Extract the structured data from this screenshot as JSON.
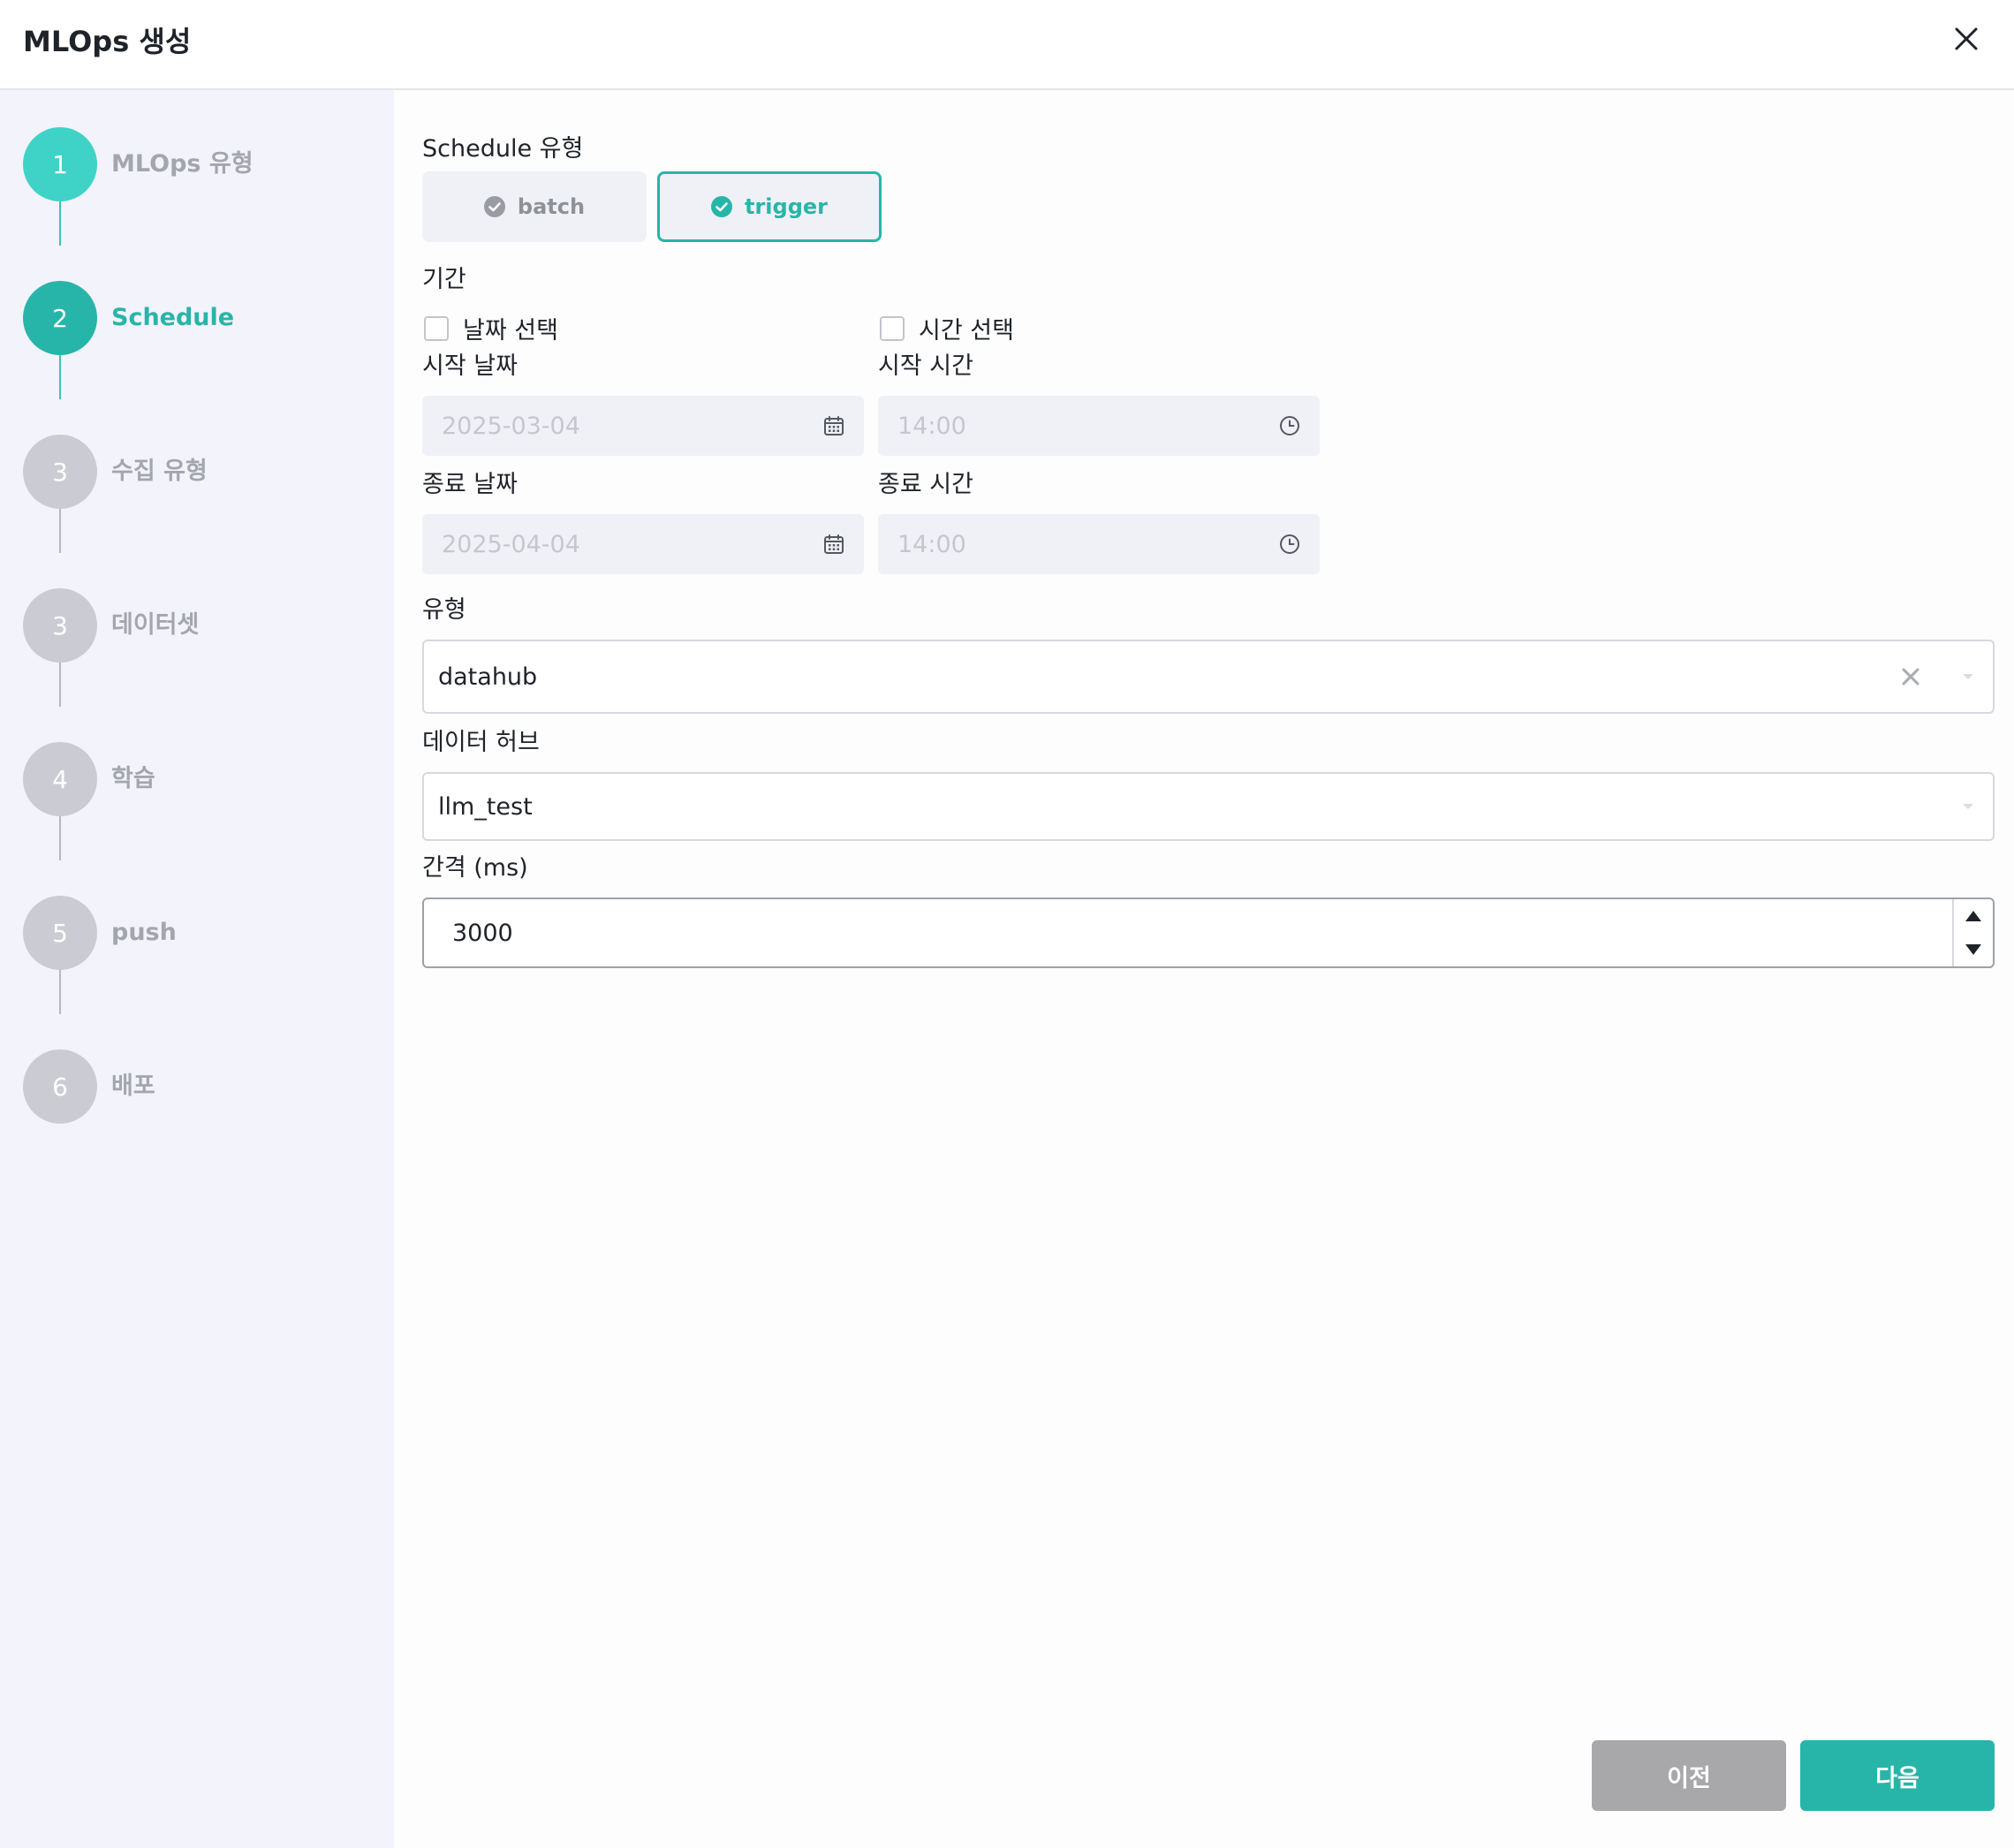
{
  "dialog": {
    "title": "MLOps 생성"
  },
  "steps": [
    {
      "number": "1",
      "label": "MLOps 유형",
      "state": "done"
    },
    {
      "number": "2",
      "label": "Schedule",
      "state": "active"
    },
    {
      "number": "3",
      "label": "수집 유형",
      "state": "pending"
    },
    {
      "number": "3",
      "label": "데이터셋",
      "state": "pending"
    },
    {
      "number": "4",
      "label": "학습",
      "state": "pending"
    },
    {
      "number": "5",
      "label": "push",
      "state": "pending"
    },
    {
      "number": "6",
      "label": "배포",
      "state": "pending"
    }
  ],
  "schedule": {
    "type_label": "Schedule 유형",
    "options": {
      "batch": "batch",
      "trigger": "trigger"
    },
    "selected": "trigger"
  },
  "period": {
    "label": "기간",
    "date_checkbox": "날짜 선택",
    "time_checkbox": "시간 선택",
    "start_date_label": "시작 날짜",
    "start_date_value": "2025-03-04",
    "start_time_label": "시작 시간",
    "start_time_value": "14:00",
    "end_date_label": "종료 날짜",
    "end_date_value": "2025-04-04",
    "end_time_label": "종료 시간",
    "end_time_value": "14:00"
  },
  "type_field": {
    "label": "유형",
    "value": "datahub"
  },
  "datahub_field": {
    "label": "데이터 허브",
    "value": "llm_test"
  },
  "interval_field": {
    "label": "간격 (ms)",
    "value": "3000"
  },
  "footer": {
    "prev_label": "이전",
    "next_label": "다음"
  },
  "colors": {
    "accent": "#28b5a9",
    "accent_light": "#3fd3c8",
    "step_pending": "#cbccd3",
    "sidebar_bg": "#f3f3fb",
    "prev_button": "#a8a8aa"
  }
}
